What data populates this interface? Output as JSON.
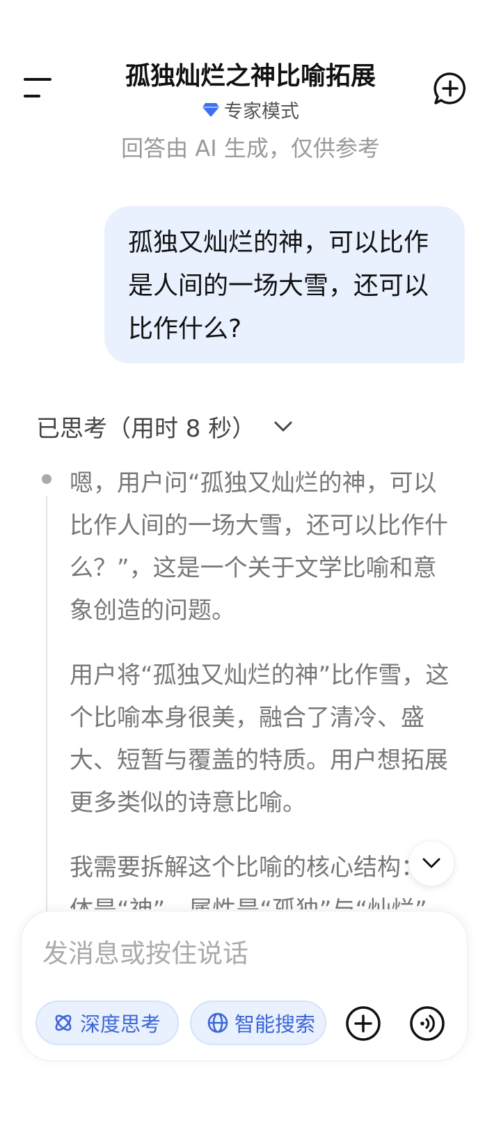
{
  "header": {
    "title": "孤独灿烂之神比喻拓展",
    "mode_label": "专家模式",
    "disclaimer": "回答由 AI 生成，仅供参考",
    "menu_icon": "menu-icon",
    "new_chat_icon": "new-chat-icon"
  },
  "conversation": {
    "user_message": "孤独又灿烂的神，可以比作是人间的一场大雪，还可以比作什么?",
    "thinking": {
      "label": "已思考（用时 8 秒）",
      "paragraphs": [
        "嗯，用户问“孤独又灿烂的神，可以比作人间的一场大雪，还可以比作什么？”，这是一个关于文学比喻和意象创造的问题。",
        "用户将“孤独又灿烂的神”比作雪，这个比喻本身很美，融合了清冷、盛大、短暂与覆盖的特质。用户想拓展更多类似的诗意比喻。",
        "我需要拆解这个比喻的核心结构：本体是“神”，属性是“孤独”与“灿烂”"
      ]
    }
  },
  "composer": {
    "placeholder": "发消息或按住说话",
    "deep_think_label": "深度思考",
    "smart_search_label": "智能搜索"
  },
  "colors": {
    "accent": "#3b66d6",
    "bubble": "#eaf1fe",
    "chip_bg": "#e9f0fe"
  }
}
